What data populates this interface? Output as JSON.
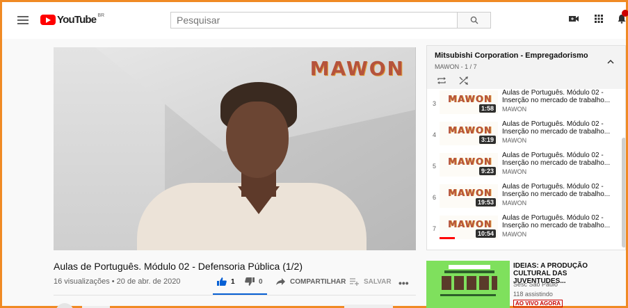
{
  "header": {
    "logo_text": "YouTube",
    "logo_country": "BR",
    "search_placeholder": "Pesquisar"
  },
  "video": {
    "watermark": "MAWON",
    "title": "Aulas de Português. Módulo 02 - Defensoria Pública (1/2)",
    "meta": "16 visualizações • 20 de abr. de 2020",
    "likes": "1",
    "dislikes": "0",
    "share_label": "COMPARTILHAR",
    "save_label": "SALVAR",
    "more_label": "•••"
  },
  "playlist": {
    "title": "Mitsubishi Corporation - Empregadorismo",
    "subtitle": "MAWON - 1 / 7",
    "items": [
      {
        "index": "3",
        "title": "Aulas de Português. Módulo 02 - Inserção no mercado de trabalho...",
        "channel": "MAWON",
        "duration": "1:58",
        "thumb_text": "MAWON"
      },
      {
        "index": "4",
        "title": "Aulas de Português. Módulo 02 - Inserção no mercado de trabalho...",
        "channel": "MAWON",
        "duration": "3:19",
        "thumb_text": "MAWON"
      },
      {
        "index": "5",
        "title": "Aulas de Português. Módulo 02 - Inserção no mercado de trabalho...",
        "channel": "MAWON",
        "duration": "9:23",
        "thumb_text": "MAWON"
      },
      {
        "index": "6",
        "title": "Aulas de Português. Módulo 02 - Inserção no mercado de trabalho...",
        "channel": "MAWON",
        "duration": "19:53",
        "thumb_text": "MAWON"
      },
      {
        "index": "7",
        "title": "Aulas de Português. Módulo 02 - Inserção no mercado de trabalho...",
        "channel": "MAWON",
        "duration": "10:54",
        "thumb_text": "MAWON"
      }
    ]
  },
  "recommendation": {
    "title": "IDEIAS: A PRODUÇÃO CULTURAL DAS JUVENTUDES...",
    "channel": "Sesc São Paulo",
    "watching": "118 assistindo",
    "live_badge": "AO VIVO AGORA"
  },
  "colors": {
    "accent_red": "#ff0000",
    "like_blue": "#065fd4",
    "frame_orange": "#f08a24"
  }
}
